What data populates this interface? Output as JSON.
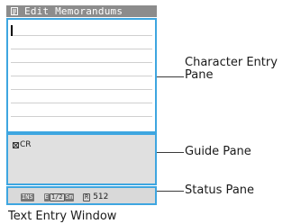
{
  "window": {
    "title": "Edit Memorandums",
    "title_icon": "memo-icon"
  },
  "guide": {
    "text": "CR",
    "icon": "x-box-icon"
  },
  "status": {
    "input_mode_badge": "INS",
    "char_badges": [
      "E",
      "1/2",
      "Sm"
    ],
    "remaining_badge": "R",
    "remaining_count": "512"
  },
  "callouts": {
    "character_entry_pane": "Character Entry Pane",
    "guide_pane": "Guide Pane",
    "status_pane": "Status Pane"
  },
  "caption": "Text Entry Window",
  "colors": {
    "pane_border": "#3ea6e0",
    "titlebar": "#8c8c8c",
    "guide_bg": "#e0e0e0",
    "status_bg": "#d9d9d9"
  }
}
